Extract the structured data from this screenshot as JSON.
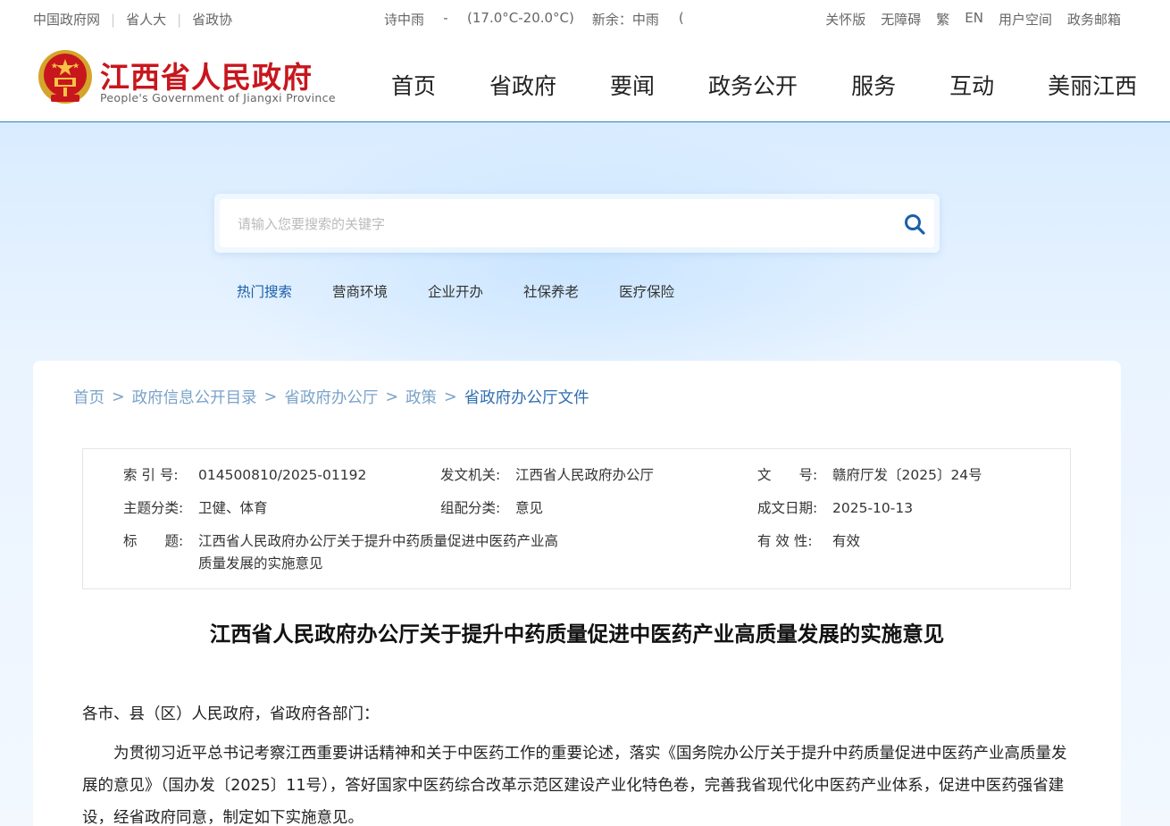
{
  "topbar": {
    "left_links": [
      "中国政府网",
      "省人大",
      "省政协"
    ],
    "weather": {
      "city1": "诗中雨",
      "dash": "-",
      "temp": "(17.0°C-20.0°C)",
      "city2": "新余：中雨",
      "trail": "("
    },
    "right_links": [
      "关怀版",
      "无障碍",
      "繁",
      "EN",
      "用户空间",
      "政务邮箱"
    ]
  },
  "header": {
    "title": "江西省人民政府",
    "subtitle": "People's Government of Jiangxi Province",
    "nav": [
      "首页",
      "省政府",
      "要闻",
      "政务公开",
      "服务",
      "互动",
      "美丽江西"
    ]
  },
  "search": {
    "placeholder": "请输入您要搜索的关键字",
    "hot_label": "热门搜索",
    "hot_keywords": [
      "营商环境",
      "企业开办",
      "社保养老",
      "医疗保险"
    ]
  },
  "breadcrumb": [
    "首页",
    "政府信息公开目录",
    "省政府办公厅",
    "政策",
    "省政府办公厅文件"
  ],
  "meta": {
    "index_label": "索 引 号:",
    "index_value": "014500810/2025-01192",
    "issuer_label": "发文机关:",
    "issuer_value": "江西省人民政府办公厅",
    "docno_label": "文　　号:",
    "docno_value": "赣府厅发〔2025〕24号",
    "topic_label": "主题分类:",
    "topic_value": "卫健、体育",
    "genre_label": "组配分类:",
    "genre_value": "意见",
    "date_label": "成文日期:",
    "date_value": "2025-10-13",
    "title_label": "标　　题:",
    "title_value_line1": "江西省人民政府办公厅关于提升中药质量促进中医药产业高",
    "title_value_line2": "质量发展的实施意见",
    "valid_label": "有 效 性:",
    "valid_value": "有效"
  },
  "article": {
    "title": "江西省人民政府办公厅关于提升中药质量促进中医药产业高质量发展的实施意见",
    "salutation": "各市、县（区）人民政府，省政府各部门：",
    "body_line1": "为贯彻习近平总书记考察江西重要讲话精神和关于中医药工作的重要论述，落实《国务院办公厅关于提升中药质量促进中医药产业高质",
    "body_line2": "量发展的意见》（国办发〔2025〕11号），答好国家中医药综合改革示范区建设产业化特色卷，完善我省现代化中医药产业体系，促进中医",
    "body_line3": "药强省建设，经省政府同意，制定如下实施意见。"
  }
}
